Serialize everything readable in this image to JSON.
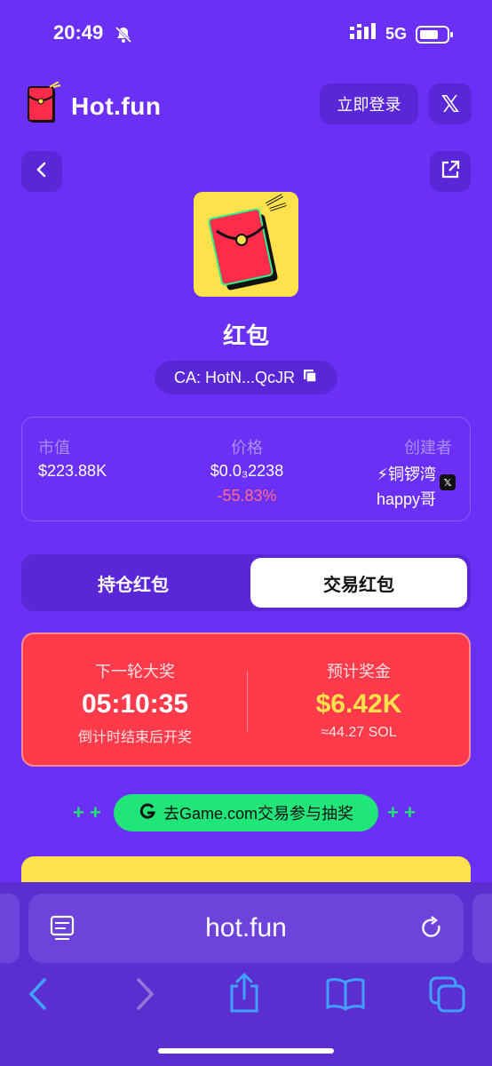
{
  "status_bar": {
    "time": "20:49",
    "network": "5G"
  },
  "header": {
    "logo_text": "Hot.fun",
    "login_label": "立即登录",
    "x_label": "𝕏"
  },
  "token": {
    "name": "红包",
    "ca": "CA: HotN...QcJR"
  },
  "stats": {
    "market_cap_label": "市值",
    "market_cap_value": "$223.88K",
    "price_label": "价格",
    "price_value": "$0.0₃2238",
    "price_change": "-55.83%",
    "creator_label": "创建者",
    "creator_name_line1": "⚡铜锣湾",
    "creator_name_line2": "happy哥"
  },
  "tabs": [
    {
      "label": "持仓红包",
      "active": false
    },
    {
      "label": "交易红包",
      "active": true
    }
  ],
  "jackpot": {
    "next_label": "下一轮大奖",
    "countdown": "05:10:35",
    "countdown_note": "倒计时结束后开奖",
    "prize_label": "预计奖金",
    "prize_value": "$6.42K",
    "prize_sol": "≈44.27 SOL"
  },
  "promo": {
    "label": "去Game.com交易参与抽奖"
  },
  "browser": {
    "url": "hot.fun"
  },
  "colors": {
    "background": "#6b30f5",
    "panel": "#5a27d8",
    "jackpot": "#ff3a4a",
    "prize": "#ffe14c",
    "promo": "#20e67a",
    "negative": "#ff6b8a"
  }
}
